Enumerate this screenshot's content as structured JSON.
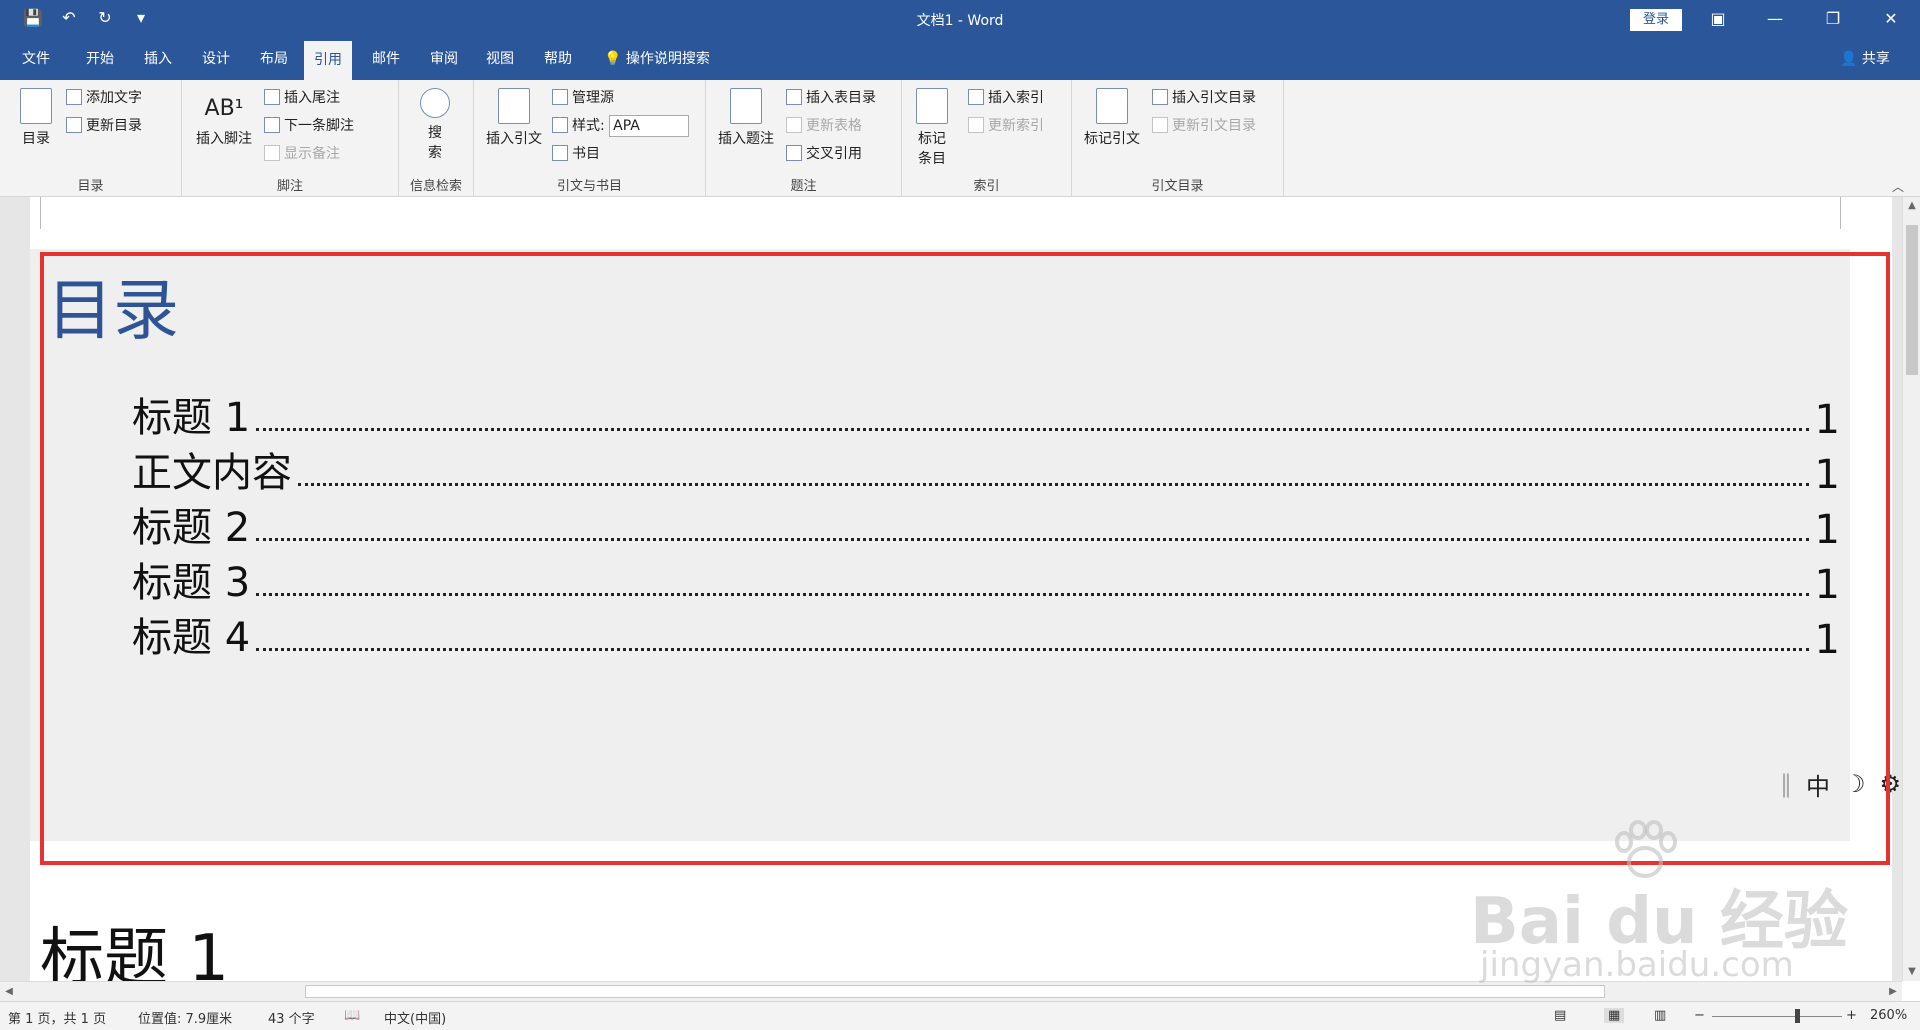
{
  "app": {
    "doc_title": "文档1 - Word",
    "login": "登录"
  },
  "tabs": [
    {
      "label": "文件"
    },
    {
      "label": "开始"
    },
    {
      "label": "插入"
    },
    {
      "label": "设计"
    },
    {
      "label": "布局"
    },
    {
      "label": "引用",
      "active": true
    },
    {
      "label": "邮件"
    },
    {
      "label": "审阅"
    },
    {
      "label": "视图"
    },
    {
      "label": "帮助"
    }
  ],
  "tell_me": "操作说明搜索",
  "share": "共享",
  "ribbon": {
    "toc": {
      "group": "目录",
      "big": "目录",
      "add_text": "添加文字",
      "update_toc": "更新目录"
    },
    "footnotes": {
      "group": "脚注",
      "big": "插入脚注",
      "insert_endnote": "插入尾注",
      "next_footnote": "下一条脚注",
      "show_notes": "显示备注"
    },
    "research": {
      "group": "信息检索",
      "big_line1": "搜",
      "big_line2": "索"
    },
    "citations": {
      "group": "引文与书目",
      "big": "插入引文",
      "manage_sources": "管理源",
      "style_label": "样式:",
      "style_value": "APA",
      "bibliography": "书目"
    },
    "captions": {
      "group": "题注",
      "big": "插入题注",
      "insert_table_of_figures": "插入表目录",
      "update_table": "更新表格",
      "cross_reference": "交叉引用"
    },
    "index": {
      "group": "索引",
      "big_line1": "标记",
      "big_line2": "条目",
      "insert_index": "插入索引",
      "update_index": "更新索引"
    },
    "toa": {
      "group": "引文目录",
      "big": "标记引文",
      "insert_toa": "插入引文目录",
      "update_toa": "更新引文目录"
    }
  },
  "document": {
    "toc_title": "目录",
    "toc_entries": [
      {
        "label": "标题 1",
        "page": "1"
      },
      {
        "label": "正文内容",
        "page": "1"
      },
      {
        "label": "标题 2",
        "page": "1"
      },
      {
        "label": "标题 3",
        "page": "1"
      },
      {
        "label": "标题 4",
        "page": "1"
      }
    ],
    "heading": "标题 1",
    "ime": {
      "mode": "中"
    }
  },
  "status": {
    "page": "第 1 页，共 1 页",
    "position": "位置值: 7.9厘米",
    "words": "43 个字",
    "language": "中文(中国)",
    "zoom": "260%"
  },
  "watermark": {
    "main": "Bai du 经验",
    "sub": "jingyan.baidu.com"
  },
  "colors": {
    "title_bar": "#2b579a",
    "toc_title": "#2f5496",
    "highlight_box": "#e8322f"
  }
}
